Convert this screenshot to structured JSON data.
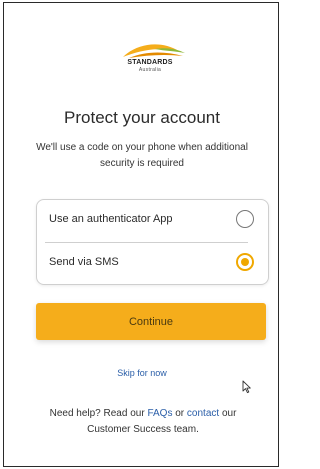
{
  "logo": {
    "brand": "STANDARDS",
    "sub": "Australia"
  },
  "title": "Protect your account",
  "subtitle": "We'll use a code on your phone when additional security is required",
  "options": [
    {
      "label": "Use an authenticator App",
      "selected": false
    },
    {
      "label": "Send via SMS",
      "selected": true
    }
  ],
  "continue_label": "Continue",
  "skip_label": "Skip for now",
  "help": {
    "prefix": "Need help? Read our ",
    "faqs_link": "FAQs",
    "middle": " or ",
    "contact_link": "contact",
    "suffix": " our Customer Success team."
  },
  "colors": {
    "accent": "#f5ad1b",
    "link": "#2a5ea8"
  }
}
